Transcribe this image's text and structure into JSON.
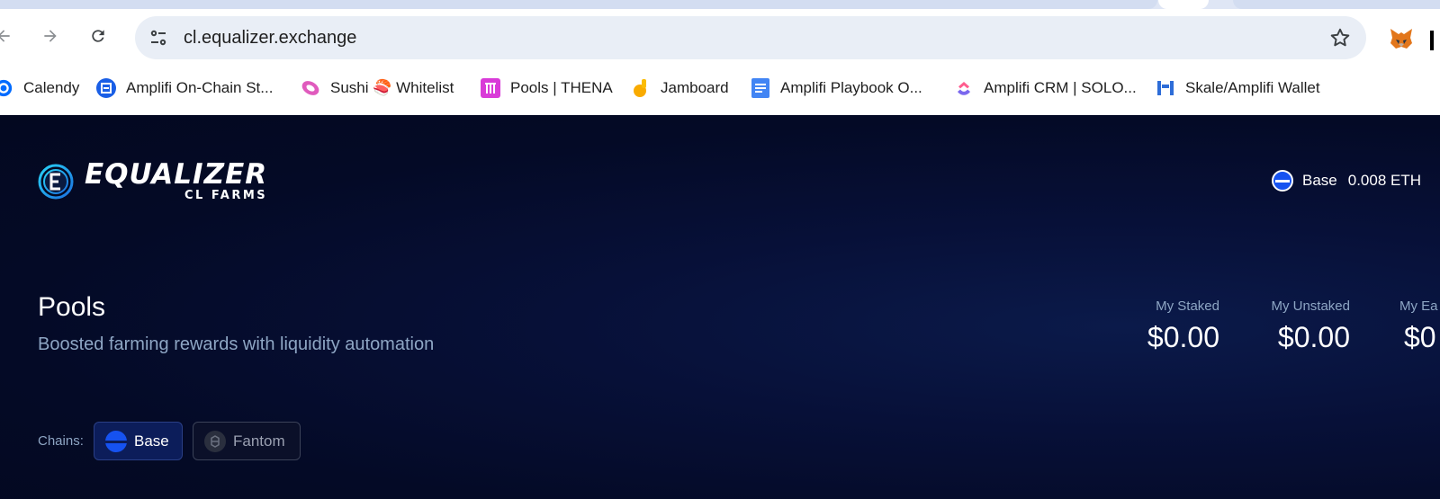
{
  "browser": {
    "url": "cl.equalizer.exchange",
    "bookmarks": [
      {
        "label": "Calendy",
        "icon": "calendly-icon"
      },
      {
        "label": "Amplifi On-Chain St...",
        "icon": "amplifi-icon"
      },
      {
        "label": "Sushi 🍣 Whitelist",
        "icon": "sushi-icon"
      },
      {
        "label": "Pools | THENA",
        "icon": "thena-icon"
      },
      {
        "label": "Jamboard",
        "icon": "jamboard-icon"
      },
      {
        "label": "Amplifi Playbook O...",
        "icon": "docs-icon"
      },
      {
        "label": "Amplifi CRM | SOLO...",
        "icon": "clickup-icon"
      },
      {
        "label": "Skale/Amplifi Wallet",
        "icon": "skale-icon"
      }
    ]
  },
  "header": {
    "logo_word": "EQUALIZER",
    "logo_sub": "CL FARMS",
    "wallet": {
      "network": "Base",
      "balance": "0.008 ETH"
    }
  },
  "main": {
    "title": "Pools",
    "subtitle": "Boosted farming rewards with liquidity automation",
    "stats": [
      {
        "label": "My Staked",
        "value": "$0.00"
      },
      {
        "label": "My Unstaked",
        "value": "$0.00"
      },
      {
        "label": "My Ea",
        "value": "$0"
      }
    ],
    "chains_label": "Chains:",
    "chains": [
      {
        "label": "Base",
        "selected": true
      },
      {
        "label": "Fantom",
        "selected": false
      }
    ]
  },
  "colors": {
    "page_bg": "#040a26",
    "accent_blue": "#1652f0",
    "muted_text": "#8ea6c4"
  }
}
